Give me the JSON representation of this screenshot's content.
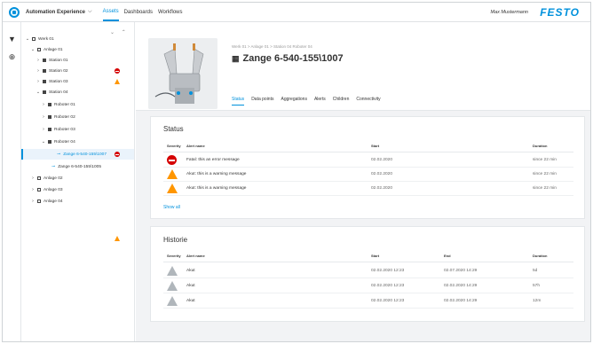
{
  "header": {
    "app_title": "Automation Experience",
    "nav": [
      "Assets",
      "Dashboards",
      "Workflows"
    ],
    "user": "Max Mustermann",
    "brand": "FESTO"
  },
  "tree": {
    "items": [
      {
        "label": "Werk 01"
      },
      {
        "label": "Anlage 01"
      },
      {
        "label": "Station 01"
      },
      {
        "label": "Station 02",
        "status": "error"
      },
      {
        "label": "Station 03",
        "status": "warning"
      },
      {
        "label": "Station 04"
      },
      {
        "label": "Roboter 01"
      },
      {
        "label": "Roboter 02"
      },
      {
        "label": "Roboter 03"
      },
      {
        "label": "Roboter 04"
      },
      {
        "label": "Zange 6-540-155\\1007",
        "status": "error",
        "selected": true
      },
      {
        "label": "Zange 6-540-155\\1005"
      },
      {
        "label": "Anlage 02"
      },
      {
        "label": "Anlage 03"
      },
      {
        "label": "Anlage 04",
        "status": "warning"
      }
    ]
  },
  "asset": {
    "breadcrumb": "Werk 01  >  Anlage 01  >  Station 04  Roboter 04",
    "title": "Zange 6-540-155\\1007",
    "tabs": [
      "Status",
      "Data points",
      "Aggregations",
      "Alerts",
      "Children",
      "Connectivity"
    ]
  },
  "status": {
    "title": "Status",
    "headers": [
      "Severity",
      "Alert name",
      "Start",
      "Duration"
    ],
    "rows": [
      {
        "severity": "error",
        "name": "Fatal: this an error message",
        "start": "02.02.2020",
        "duration": "since 22 min"
      },
      {
        "severity": "warning",
        "name": "Akut: this is a warning message",
        "start": "02.02.2020",
        "duration": "since 22 min"
      },
      {
        "severity": "warning",
        "name": "Akut: this is a warning message",
        "start": "02.02.2020",
        "duration": "since 22 min"
      }
    ],
    "show_all": "Show all"
  },
  "history": {
    "title": "Historie",
    "headers": [
      "Severity",
      "Alert name",
      "Start",
      "End",
      "Duration"
    ],
    "rows": [
      {
        "name": "Akut",
        "start": "02.02.2020  12:23",
        "end": "02.07.2020  14:29",
        "duration": "5d"
      },
      {
        "name": "Akut",
        "start": "02.02.2020  12:23",
        "end": "02.02.2020  14:29",
        "duration": "57h"
      },
      {
        "name": "Akut",
        "start": "02.02.2020  12:23",
        "end": "02.02.2020  14:29",
        "duration": "12m"
      }
    ]
  },
  "colors": {
    "accent": "#0091dc",
    "error": "#d50000",
    "warning": "#ff9600",
    "inactive": "#b0b6bb"
  }
}
